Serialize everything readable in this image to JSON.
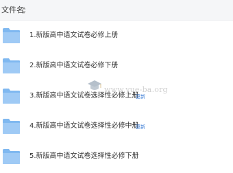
{
  "header": {
    "column_label": "文件名",
    "sort_icon": "sort-updown-icon"
  },
  "files": [
    {
      "name": "1.新版高中语文试卷必修上册",
      "icon": "folder-icon",
      "badge": ""
    },
    {
      "name": "2.新版高中语文试卷必修下册",
      "icon": "folder-icon",
      "badge": ""
    },
    {
      "name": "3.新版高中语文试卷选择性必修上册",
      "icon": "folder-icon",
      "badge": "更新"
    },
    {
      "name": "4.新版高中语文试卷选择性必修中册",
      "icon": "folder-icon",
      "badge": "更新"
    },
    {
      "name": "5.新版高中语文试卷选择性必修下册",
      "icon": "folder-icon",
      "badge": ""
    }
  ],
  "watermark": {
    "text": "www.yue-ba.org",
    "icon": "graduation-cap-icon"
  },
  "colors": {
    "folder": "#7fb8f0",
    "folder_light": "#a9d2f7",
    "badge": "#3a7bd5",
    "header_bg": "#f5f6f8"
  }
}
